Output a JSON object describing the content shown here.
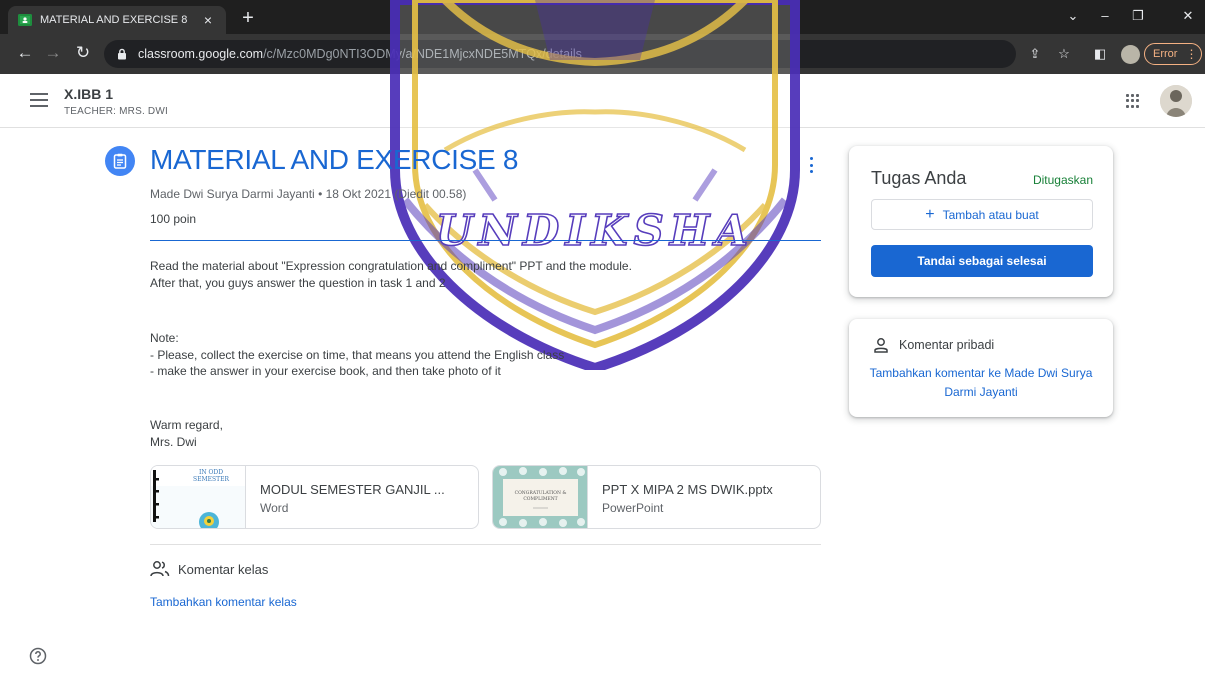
{
  "browser": {
    "tab_title": "MATERIAL AND EXERCISE 8",
    "tab_close": "×",
    "new_tab": "+",
    "url_host": "classroom.google.com",
    "url_path": "/c/Mzc0MDg0NTI3ODMy/a/NDE1MjcxNDE5MTQx/details",
    "error_label": "Error",
    "window_controls": [
      "chevron-down-icon",
      "minimize-icon",
      "restore-icon",
      "close-icon"
    ]
  },
  "classroom": {
    "class_name": "X.IBB 1",
    "teacher": "TEACHER: MRS. DWI"
  },
  "watermark": {
    "text": "UNDIKSHA"
  },
  "assignment": {
    "title": "MATERIAL AND EXERCISE 8",
    "author": "Made Dwi Surya Darmi Jayanti",
    "separator": "•",
    "date": "18 Okt 2021 (Diedit 00.58)",
    "points": "100 poin",
    "paragraph1": "Read the material about \"Expression congratulation and compliment\" PPT and the module.\nAfter that, you guys answer the question in task 1 and 2",
    "paragraph2": "Note:\n- Please, collect the exercise on time, that means you attend the English class\n- make the answer in your exercise book, and then take photo of it",
    "paragraph3": "Warm regard,\nMrs. Dwi",
    "attachments": [
      {
        "name": "MODUL SEMESTER GANJIL ...",
        "type": "Word",
        "thumb_text": "IN ODD\nSEMESTER"
      },
      {
        "name": "PPT X MIPA 2 MS DWIK.pptx",
        "type": "PowerPoint",
        "thumb_text": "CONGRATULATION &\nCOMPLIMENT"
      }
    ],
    "class_comments_label": "Komentar kelas",
    "add_class_comment": "Tambahkan komentar kelas"
  },
  "your_work": {
    "title": "Tugas Anda",
    "status": "Ditugaskan",
    "status_color": "#188038",
    "add_or_create": "Tambah atau buat",
    "mark_done": "Tandai sebagai selesai"
  },
  "private_comments": {
    "label": "Komentar pribadi",
    "add": "Tambahkan komentar ke Made Dwi Surya Darmi Jayanti"
  },
  "colors": {
    "accent": "#1967d2",
    "assignment_icon": "#4285f4",
    "watermark": "#4b2fb8"
  }
}
